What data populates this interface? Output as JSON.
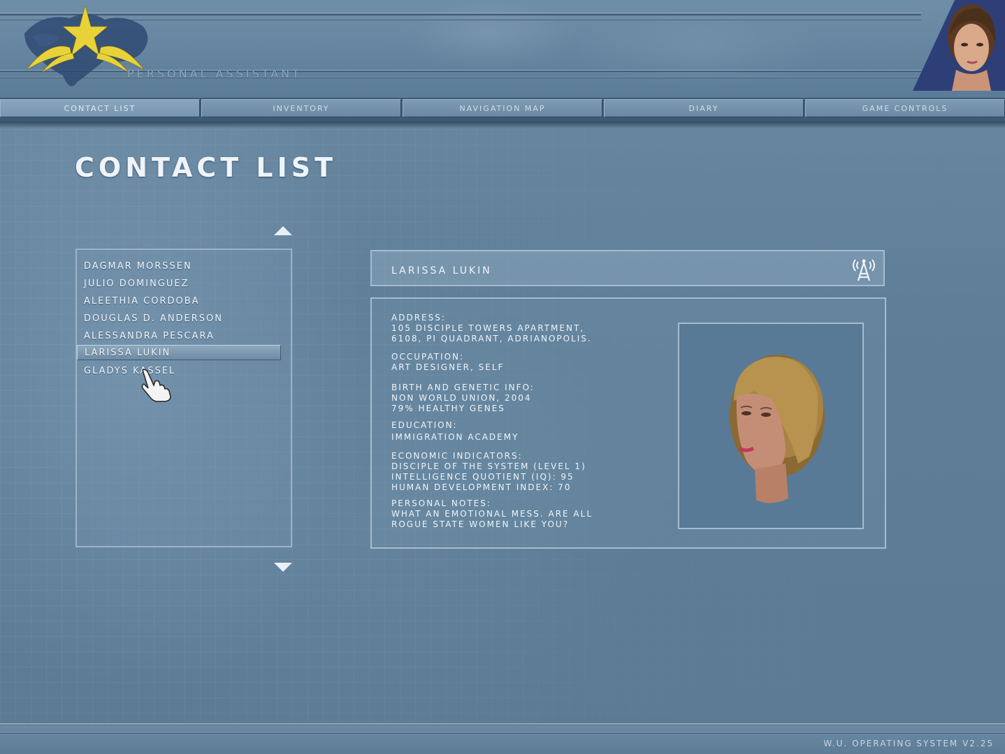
{
  "header": {
    "title": "PERSONAL ASSISTANT"
  },
  "tabs": [
    {
      "label": "CONTACT LIST",
      "active": true
    },
    {
      "label": "INVENTORY",
      "active": false
    },
    {
      "label": "NAVIGATION MAP",
      "active": false
    },
    {
      "label": "DIARY",
      "active": false
    },
    {
      "label": "GAME CONTROLS",
      "active": false
    }
  ],
  "page": {
    "title": "CONTACT LIST"
  },
  "contacts": [
    {
      "name": "DAGMAR MORSSEN",
      "selected": false
    },
    {
      "name": "JULIO DOMINGUEZ",
      "selected": false
    },
    {
      "name": "ALEETHIA CORDOBA",
      "selected": false
    },
    {
      "name": "DOUGLAS D. ANDERSON",
      "selected": false
    },
    {
      "name": "ALESSANDRA PESCARA",
      "selected": false
    },
    {
      "name": "LARISSA LUKIN",
      "selected": true
    },
    {
      "name": "GLADYS KASSEL",
      "selected": false
    }
  ],
  "detail": {
    "name": "LARISSA LUKIN",
    "call_icon": "antenna-icon",
    "fields": [
      {
        "label": "ADDRESS:",
        "value": [
          "105 DISCIPLE TOWERS APARTMENT,",
          "6108, PI QUADRANT, ADRIANOPOLIS."
        ]
      },
      {
        "label": "OCCUPATION:",
        "value": [
          "ART DESIGNER, SELF"
        ]
      },
      {
        "label": "BIRTH AND GENETIC INFO:",
        "value": [
          "NON WORLD UNION, 2004",
          "79% HEALTHY GENES"
        ]
      },
      {
        "label": "EDUCATION:",
        "value": [
          "IMMIGRATION ACADEMY"
        ]
      },
      {
        "label": "ECONOMIC INDICATORS:",
        "value": [
          "DISCIPLE OF THE SYSTEM (LEVEL 1)",
          "INTELLIGENCE QUOTIENT (IQ): 95",
          "HUMAN DEVELOPMENT INDEX: 70"
        ]
      },
      {
        "label": "PERSONAL NOTES:",
        "value": [
          "WHAT AN EMOTIONAL MESS. ARE ALL",
          "ROGUE STATE WOMEN LIKE YOU?"
        ]
      }
    ]
  },
  "footer": {
    "version": "W.U. OPERATING SYSTEM V2.25"
  },
  "colors": {
    "background": "#5f7f99",
    "panel_border": "#a6bccd",
    "text": "#eef4f9",
    "logo_gold": "#e8d23a"
  }
}
